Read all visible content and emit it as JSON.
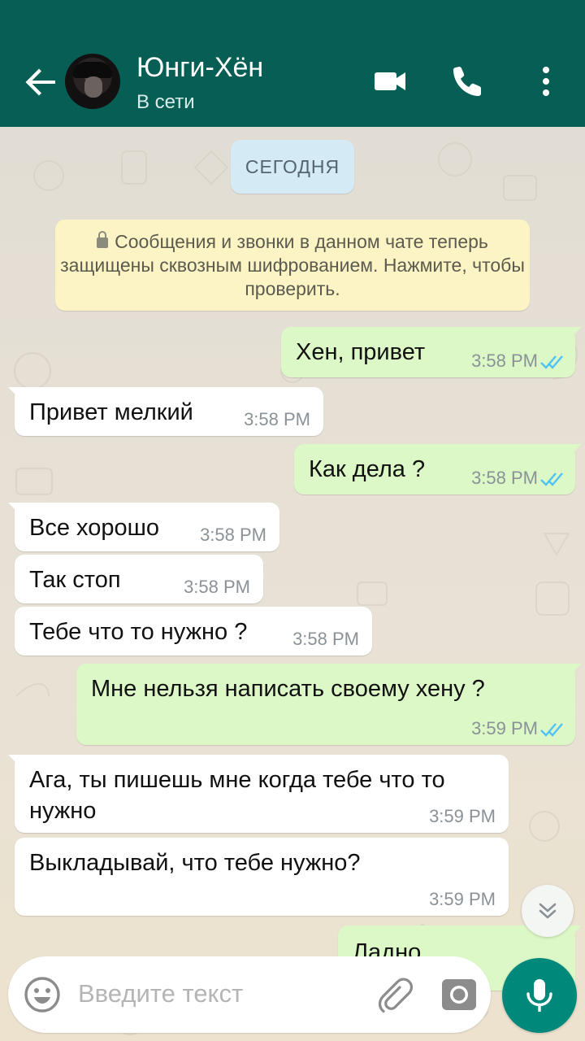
{
  "header": {
    "contact_name": "Юнги-Хён",
    "status": "В сети",
    "bg_color": "#075e54"
  },
  "chat": {
    "date_label": "СЕГОДНЯ",
    "encryption_notice": "Сообщения и звонки в данном чате теперь защищены сквозным шифрованием. Нажмите, чтобы проверить.",
    "messages": [
      {
        "dir": "out",
        "text": "Хен, привет",
        "time": "3:58 PM",
        "read": true
      },
      {
        "dir": "in",
        "text": "Привет мелкий",
        "time": "3:58 PM"
      },
      {
        "dir": "out",
        "text": "Как дела ?",
        "time": "3:58 PM",
        "read": true
      },
      {
        "dir": "in",
        "text": "Все хорошо",
        "time": "3:58 PM"
      },
      {
        "dir": "in",
        "text": "Так стоп",
        "time": "3:58 PM"
      },
      {
        "dir": "in",
        "text": "Тебе что то нужно ?",
        "time": "3:58 PM"
      },
      {
        "dir": "out",
        "text": "Мне нельзя написать своему хену ?",
        "time": "3:59 PM",
        "read": true
      },
      {
        "dir": "in",
        "text": "Ага, ты пишешь мне когда тебе что то нужно",
        "time": "3:59 PM"
      },
      {
        "dir": "in",
        "text": "Выкладывай,  что тебе нужно?",
        "time": "3:59 PM"
      },
      {
        "dir": "out",
        "text": "Ладно",
        "time": ""
      }
    ]
  },
  "composer": {
    "placeholder": "Введите текст"
  },
  "colors": {
    "outgoing_bubble": "#dcf8c6",
    "incoming_bubble": "#ffffff",
    "read_ticks": "#4fc3f7",
    "accent": "#00897b"
  },
  "icons": [
    "back-arrow-icon",
    "video-call-icon",
    "phone-icon",
    "more-vert-icon",
    "lock-icon",
    "double-check-icon",
    "chevron-double-down-icon",
    "emoji-icon",
    "paperclip-icon",
    "camera-icon",
    "microphone-icon"
  ]
}
